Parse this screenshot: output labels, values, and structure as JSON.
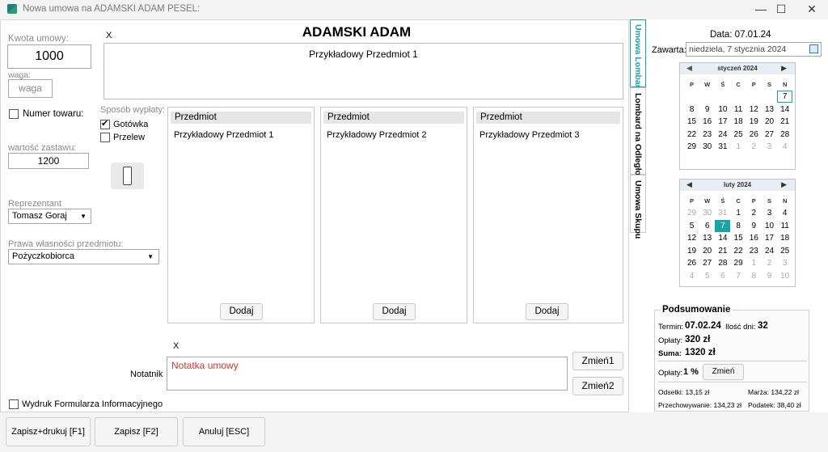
{
  "window": {
    "title": "Nowa umowa na ADAMSKI ADAM PESEL:",
    "minimize": "—",
    "maximize": "☐",
    "close": "✕"
  },
  "left": {
    "kwota_label": "Kwota umowy:",
    "kwota_value": "1000",
    "waga_label": "waga:",
    "waga_placeholder": "waga",
    "numer_towaru_label": "Numer towaru:",
    "wartosc_label": "wartość zastawu:",
    "wartosc_value": "1200",
    "reprezentant_label": "Reprezentant",
    "reprezentant_value": "Tomasz Goraj",
    "prawa_label": "Prawa własności przedmiotu:",
    "prawa_value": "Pożyczkobiorca",
    "sposob_label": "Sposób wypłaty:",
    "gotowka_label": "Gotówka",
    "przelew_label": "Przelew",
    "wydruk_label": "Wydruk Formularza Informacyjnego"
  },
  "header": {
    "x_mark": "X",
    "client_name": "ADAMSKI ADAM",
    "item_title": "Przykładowy Przedmiot 1"
  },
  "items": [
    {
      "header": "Przedmiot",
      "name": "Przykładowy Przedmiot 1",
      "add": "Dodaj"
    },
    {
      "header": "Przedmiot",
      "name": "Przykładowy Przedmiot 2",
      "add": "Dodaj"
    },
    {
      "header": "Przedmiot",
      "name": "Przykładowy Przedmiot 3",
      "add": "Dodaj"
    }
  ],
  "notes": {
    "x_mark": "X",
    "label": "Notatnik",
    "value": "Notatka umowy",
    "zmien1": "Zmień1",
    "zmien2": "Zmień2"
  },
  "tabs": [
    "Umowa Lombard",
    "Lombard na Odległość",
    "Umowa Skupu"
  ],
  "right": {
    "date_label": "Data: 07.01.24",
    "zawarta_label": "Zawarta:",
    "zawarta_value": "niedziela, 7 stycznia 2024",
    "cal1": {
      "month": "styczeń 2024",
      "dow": [
        "P",
        "W",
        "Ś",
        "C",
        "P",
        "S",
        "N"
      ],
      "rows": [
        [
          "",
          "",
          "",
          "",
          "",
          "",
          "7"
        ],
        [
          "8",
          "9",
          "10",
          "11",
          "12",
          "13",
          "14"
        ],
        [
          "15",
          "16",
          "17",
          "18",
          "19",
          "20",
          "21"
        ],
        [
          "22",
          "23",
          "24",
          "25",
          "26",
          "27",
          "28"
        ],
        [
          "29",
          "30",
          "31",
          "1",
          "2",
          "3",
          "4"
        ]
      ]
    },
    "cal2": {
      "month": "luty 2024",
      "dow": [
        "P",
        "W",
        "Ś",
        "C",
        "P",
        "S",
        "N"
      ],
      "rows": [
        [
          "29",
          "30",
          "31",
          "1",
          "2",
          "3",
          "4"
        ],
        [
          "5",
          "6",
          "7",
          "8",
          "9",
          "10",
          "11"
        ],
        [
          "12",
          "13",
          "14",
          "15",
          "16",
          "17",
          "18"
        ],
        [
          "19",
          "20",
          "21",
          "22",
          "23",
          "24",
          "25"
        ],
        [
          "26",
          "27",
          "28",
          "29",
          "1",
          "2",
          "3"
        ],
        [
          "4",
          "5",
          "6",
          "7",
          "8",
          "9",
          "10"
        ]
      ]
    },
    "accent": "#1aa3a3"
  },
  "summary": {
    "title": "Podsumowanie",
    "termin_label": "Termin:",
    "termin_value": "07.02.24",
    "ilosc_label": "Ilość dni:",
    "ilosc_value": "32",
    "oplaty_label": "Opłaty:",
    "oplaty_value": "320 zł",
    "suma_label": "Suma:",
    "suma_value": "1320 zł",
    "oplaty_pct_label": "Opłaty:",
    "oplaty_pct_value": "1 %",
    "zmien": "Zmień",
    "odsetki": "Odsetki: 13,15 zł",
    "marza": "Marża:  134,22 zł",
    "przechowywanie": "Przechowywanie: 134,23 zł",
    "podatek": "Podatek: 38,40 zł"
  },
  "bottom": {
    "zapisz_drukuj": "Zapisz+drukuj [F1]",
    "zapisz": "Zapisz [F2]",
    "anuluj": "Anuluj [ESC]"
  }
}
